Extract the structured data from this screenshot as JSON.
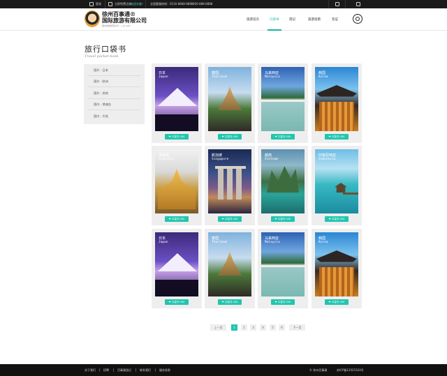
{
  "topbar": {
    "items": [
      "登录",
      "立即免费注册",
      "欢迎光临！",
      "全国客服热线：0516-8888-8888",
      "400-888-8888"
    ]
  },
  "header": {
    "logo_title_line1": "徐州百事通®",
    "logo_title_line2": "国际旅游有限公司",
    "logo_subtitle": "国内旅游经营许可：L-JS-CJ00",
    "nav": [
      "旅游首页",
      "口袋书",
      "游记",
      "旅游指南",
      "签证"
    ]
  },
  "page": {
    "title": "旅行口袋书",
    "subtitle": "Travel pocket book"
  },
  "sidebar": {
    "items": [
      "国外 - 日本",
      "国外 - 欧洲",
      "国外 - 其他",
      "国内 - 港澳台",
      "国内 - 大陆"
    ]
  },
  "cards": [
    {
      "cn": "日本",
      "en": "Japan",
      "btn": "❤ 口袋书 430"
    },
    {
      "cn": "泰国",
      "en": "Thailand",
      "btn": "❤ 口袋书 430"
    },
    {
      "cn": "马来西亚",
      "en": "Malaysia",
      "btn": "❤ 口袋书 430"
    },
    {
      "cn": "韩国",
      "en": "Korea",
      "btn": "❤ 口袋书 430"
    },
    {
      "cn": "柬埔寨",
      "en": "Cambodia",
      "btn": "❤ 口袋书 430"
    },
    {
      "cn": "新加坡",
      "en": "Singapore",
      "btn": "❤ 口袋书 430"
    },
    {
      "cn": "越南",
      "en": "Vietnam",
      "btn": "❤ 口袋书 430"
    },
    {
      "cn": "印度尼西亚",
      "en": "Indonesia",
      "btn": "❤ 口袋书 430"
    },
    {
      "cn": "日本",
      "en": "Japan",
      "btn": "❤ 口袋书 430"
    },
    {
      "cn": "泰国",
      "en": "Thailand",
      "btn": "❤ 口袋书 430"
    },
    {
      "cn": "马来西亚",
      "en": "Malaysia",
      "btn": "❤ 口袋书 430"
    },
    {
      "cn": "韩国",
      "en": "Korea",
      "btn": "❤ 口袋书 430"
    }
  ],
  "pagination": {
    "prev": "上一页",
    "pages": [
      "1",
      "2",
      "3",
      "4",
      "5",
      "6"
    ],
    "next": "下一页",
    "current": "1"
  },
  "footer": {
    "links": [
      "关于我们",
      "招聘",
      "百事通游记",
      "联系我们",
      "服务条款"
    ],
    "copyright": "© 徐州百事通",
    "icp": "苏ICP备12025324号"
  },
  "colors": {
    "accent": "#22c5ae",
    "topbar": "#1a1a1a",
    "footer": "#111111",
    "card_bg": "#eeeeee"
  }
}
